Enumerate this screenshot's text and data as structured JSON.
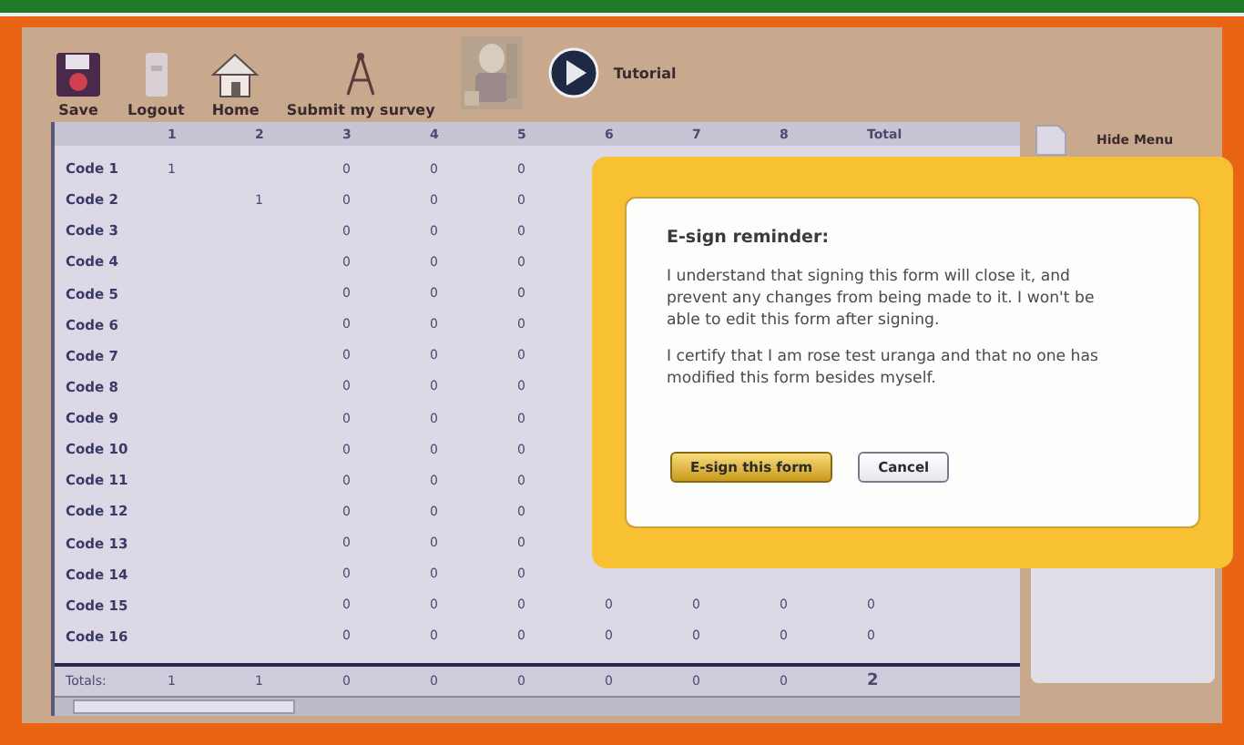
{
  "toolbar": [
    {
      "kind": "save",
      "label": "Save"
    },
    {
      "kind": "logout",
      "label": "Logout"
    },
    {
      "kind": "home",
      "label": "Home"
    },
    {
      "kind": "submit",
      "label": "Submit my survey"
    },
    {
      "kind": "picture"
    },
    {
      "kind": "tutorial",
      "label": "Tutorial"
    }
  ],
  "table": {
    "columns": [
      "1",
      "2",
      "3",
      "4",
      "5",
      "6",
      "7",
      "8",
      "Total"
    ],
    "rows": [
      {
        "label": "Code 1",
        "cells": [
          "1",
          null,
          "0",
          "0",
          "0"
        ]
      },
      {
        "label": "Code 2",
        "cells": [
          null,
          "1",
          "0",
          "0",
          "0"
        ]
      },
      {
        "label": "Code 3",
        "cells": [
          null,
          null,
          "0",
          "0",
          "0"
        ]
      },
      {
        "label": "Code 4",
        "cells": [
          null,
          null,
          "0",
          "0",
          "0"
        ]
      },
      {
        "label": "Code 5",
        "cells": [
          null,
          null,
          "0",
          "0",
          "0"
        ]
      },
      {
        "label": "Code 6",
        "cells": [
          null,
          null,
          "0",
          "0",
          "0"
        ]
      },
      {
        "label": "Code 7",
        "cells": [
          null,
          null,
          "0",
          "0",
          "0"
        ]
      },
      {
        "label": "Code 8",
        "cells": [
          null,
          null,
          "0",
          "0",
          "0"
        ]
      },
      {
        "label": "Code 9",
        "cells": [
          null,
          null,
          "0",
          "0",
          "0"
        ]
      },
      {
        "label": "Code 10",
        "cells": [
          null,
          null,
          "0",
          "0",
          "0"
        ]
      },
      {
        "label": "Code 11",
        "cells": [
          null,
          null,
          "0",
          "0",
          "0"
        ]
      },
      {
        "label": "Code 12",
        "cells": [
          null,
          null,
          "0",
          "0",
          "0"
        ]
      },
      {
        "label": "Code 13",
        "cells": [
          null,
          null,
          "0",
          "0",
          "0"
        ]
      },
      {
        "label": "Code 14",
        "cells": [
          null,
          null,
          "0",
          "0",
          "0"
        ]
      },
      {
        "label": "Code 15",
        "cells": [
          null,
          null,
          "0",
          "0",
          "0",
          "0",
          "0",
          "0",
          "0"
        ]
      },
      {
        "label": "Code 16",
        "cells": [
          null,
          null,
          "0",
          "0",
          "0",
          "0",
          "0",
          "0",
          "0"
        ]
      }
    ],
    "totals": {
      "label": "Totals:",
      "cells": [
        "1",
        "1",
        "0",
        "0",
        "0",
        "0",
        "0",
        "0",
        "2"
      ]
    }
  },
  "side_menu": {
    "toggle": "Hide Menu"
  },
  "dialog": {
    "title": "E-sign reminder:",
    "paragraphs": [
      "I understand that signing this form will close it, and prevent any changes from being made to it. I won't be able to edit this form after signing.",
      "I certify that I am rose test uranga and that no one has modified this form besides myself."
    ],
    "buttons": [
      {
        "label": "E-sign this form",
        "primary": true
      },
      {
        "label": "Cancel",
        "primary": false
      }
    ]
  }
}
